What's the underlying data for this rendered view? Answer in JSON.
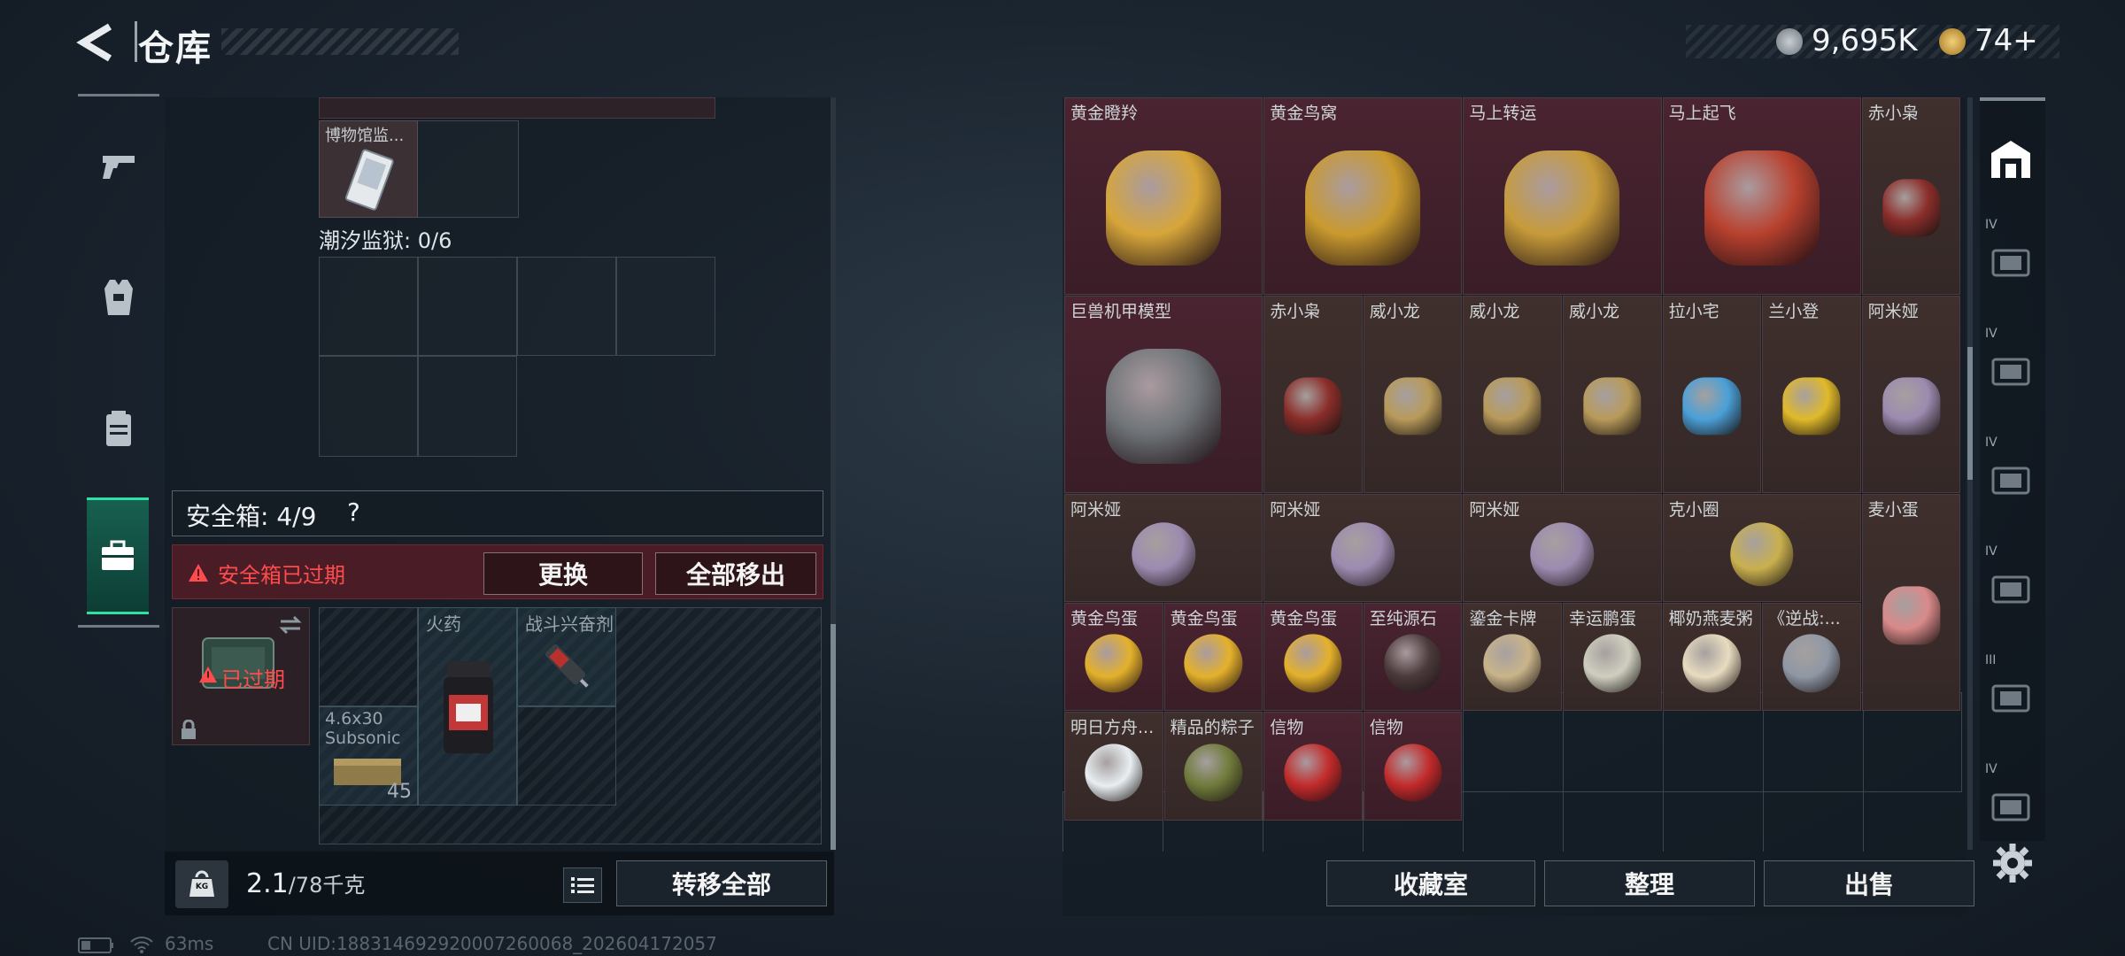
{
  "header": {
    "title": "仓库",
    "currency1": "9,695K",
    "currency2": "74+"
  },
  "left_panel": {
    "museum_item": "博物馆监...",
    "tide_prison": "潮汐监狱: 0/6",
    "safebox": {
      "label": "安全箱: 4/9",
      "help": "?",
      "expired_notice": "安全箱已过期",
      "replace_button": "更换",
      "move_all_button": "全部移出",
      "expired_tag": "已过期",
      "items": [
        {
          "name": "火药"
        },
        {
          "name": "战斗兴奋剂"
        },
        {
          "name": "4.6x30 Subsonic",
          "count": "45"
        }
      ]
    },
    "weight": {
      "value": "2.1",
      "capacity": "/78千克"
    },
    "kg_icon": "KG",
    "transfer_all_button": "转移全部"
  },
  "right_panel": {
    "items": [
      {
        "name": "黄金瞪羚",
        "bg": "red"
      },
      {
        "name": "黄金鸟窝",
        "bg": "red"
      },
      {
        "name": "马上转运",
        "bg": "red"
      },
      {
        "name": "马上起飞",
        "bg": "red"
      },
      {
        "name": "赤小枭",
        "bg": "brown"
      },
      {
        "name": "巨兽机甲模型",
        "bg": "red"
      },
      {
        "name": "赤小枭",
        "bg": "brown"
      },
      {
        "name": "威小龙",
        "bg": "brown"
      },
      {
        "name": "威小龙",
        "bg": "brown"
      },
      {
        "name": "威小龙",
        "bg": "brown"
      },
      {
        "name": "拉小宅",
        "bg": "brown"
      },
      {
        "name": "兰小登",
        "bg": "brown"
      },
      {
        "name": "阿米娅",
        "bg": "brown"
      },
      {
        "name": "阿米娅",
        "bg": "brown"
      },
      {
        "name": "阿米娅",
        "bg": "brown"
      },
      {
        "name": "阿米娅",
        "bg": "brown"
      },
      {
        "name": "克小圈",
        "bg": "brown"
      },
      {
        "name": "麦小蛋",
        "bg": "brown"
      },
      {
        "name": "黄金鸟蛋",
        "bg": "red"
      },
      {
        "name": "黄金鸟蛋",
        "bg": "red"
      },
      {
        "name": "黄金鸟蛋",
        "bg": "red"
      },
      {
        "name": "至纯源石",
        "bg": "red"
      },
      {
        "name": "鎏金卡牌",
        "bg": "brown"
      },
      {
        "name": "幸运鹏蛋",
        "bg": "brown"
      },
      {
        "name": "椰奶燕麦粥",
        "bg": "brown"
      },
      {
        "name": "《逆战:...",
        "bg": "brown"
      },
      {
        "name": "明日方舟...",
        "bg": "brown"
      },
      {
        "name": "精品的粽子",
        "bg": "brown"
      },
      {
        "name": "信物",
        "bg": "red"
      },
      {
        "name": "信物",
        "bg": "red"
      }
    ],
    "buttons": {
      "collection": "收藏室",
      "organize": "整理",
      "sell": "出售"
    }
  },
  "right_sidebar": {
    "tiers": [
      "IV",
      "IV",
      "IV",
      "IV",
      "III",
      "IV"
    ]
  },
  "status": {
    "ping": "63ms",
    "uid": "CN UID:18831469292000726006​8_202604172057"
  },
  "colors": {
    "accent": "#2fe0a4",
    "alert": "#ff4b4b",
    "red_tile": "#4a2430",
    "brown_tile": "#3f2f2d"
  }
}
